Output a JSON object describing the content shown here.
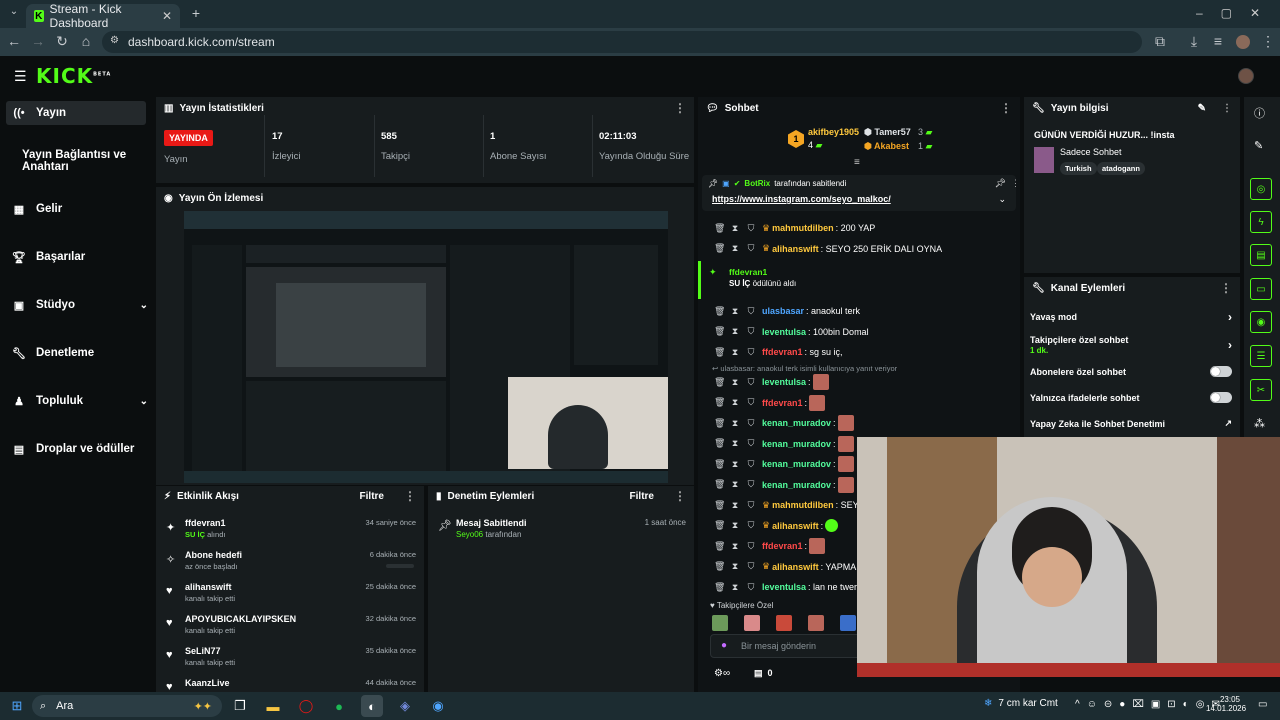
{
  "browser": {
    "tab_title": "Stream - Kick Dashboard",
    "url": "dashboard.kick.com/stream"
  },
  "kick": {
    "logo": "KICK",
    "logo_tag": "BETA"
  },
  "nav": {
    "items": [
      {
        "label": "Yayın",
        "icon": "broadcast-icon"
      },
      {
        "label": "Yayın Bağlantısı ve Anahtarı",
        "icon": ""
      },
      {
        "label": "Gelir",
        "icon": "revenue-icon"
      },
      {
        "label": "Başarılar",
        "icon": "trophy-icon"
      },
      {
        "label": "Stüdyo",
        "icon": "studio-icon"
      },
      {
        "label": "Denetleme",
        "icon": "wrench-icon"
      },
      {
        "label": "Topluluk",
        "icon": "community-icon"
      },
      {
        "label": "Droplar ve ödüller",
        "icon": "gift-icon"
      }
    ]
  },
  "stats": {
    "title": "Yayın İstatistikleri",
    "live_badge": "YAYINDA",
    "live_label": "Yayın",
    "viewers": "17",
    "viewers_label": "İzleyici",
    "followers": "585",
    "followers_label": "Takipçi",
    "subs": "1",
    "subs_label": "Abone Sayısı",
    "duration": "02:11:03",
    "duration_label": "Yayında Olduğu Süre"
  },
  "preview": {
    "title": "Yayın Ön İzlemesi"
  },
  "activity": {
    "title": "Etkinlik Akışı",
    "filter": "Filtre",
    "items": [
      {
        "name": "ffdevran1",
        "desc_green": "SU İÇ",
        "desc": " alındı",
        "time": "34 saniye önce"
      },
      {
        "name": "Abone hedefi",
        "desc_green": "",
        "desc": "az önce başladı",
        "time": "6 dakika önce"
      },
      {
        "name": "alihanswift",
        "desc_green": "",
        "desc": "kanalı takip etti",
        "time": "25 dakika önce"
      },
      {
        "name": "APOYUBICAKLAYIPSKEN",
        "desc_green": "",
        "desc": "kanalı takip etti",
        "time": "32 dakika önce"
      },
      {
        "name": "SeLiN77",
        "desc_green": "",
        "desc": "kanalı takip etti",
        "time": "35 dakika önce"
      },
      {
        "name": "KaanzLive",
        "desc_green": "",
        "desc": "",
        "time": "44 dakika önce"
      }
    ]
  },
  "moderation": {
    "title": "Denetim Eylemleri",
    "filter": "Filtre",
    "item_title": "Mesaj Sabitlendi",
    "item_user": "Seyo06",
    "item_suffix": " tarafından",
    "item_time": "1 saat önce"
  },
  "chat": {
    "title": "Sohbet",
    "top_user1": "akifbey1905",
    "top_user1_count": "4",
    "top_user2": "Tamer57",
    "top_user2_count": "3",
    "top_user3": "Akabest",
    "top_user3_count": "1",
    "pinned_by": "BotRix",
    "pinned_suffix": " tarafından sabitlendi",
    "pinned_link": "https://www.instagram.com/seyo_malkoc/",
    "reward_user": "ffdevran1",
    "reward_text": "SU İÇ",
    "reward_suffix": " ödülünü aldı",
    "reply_hint": "ulasbasar: anaokul terk isimli kullanıcıya yanıt veriyor",
    "messages": [
      {
        "user": "mahmutdilben",
        "text": ": 200 YAP",
        "color": "#ffc93e"
      },
      {
        "user": "alihanswift",
        "text": ": SEYO 250 ERİK DALI OYNA",
        "color": "#ffc93e"
      }
    ],
    "messages2": [
      {
        "user": "ulasbasar",
        "text": ": anaokul terk",
        "color": "#4fa6ff"
      },
      {
        "user": "leventulsa",
        "text": ": 100bin Domal",
        "color": "#53fc9c"
      },
      {
        "user": "ffdevran1",
        "text": ": sg su iç,",
        "color": "#ff4a4a"
      }
    ],
    "messages3": [
      {
        "user": "leventulsa",
        "text": ":",
        "color": "#53fc9c"
      },
      {
        "user": "ffdevran1",
        "text": ":",
        "color": "#ff4a4a"
      },
      {
        "user": "kenan_muradov",
        "text": ":",
        "color": "#53fc9c"
      },
      {
        "user": "kenan_muradov",
        "text": ":",
        "color": "#53fc9c"
      },
      {
        "user": "kenan_muradov",
        "text": ":",
        "color": "#53fc9c"
      },
      {
        "user": "kenan_muradov",
        "text": ":",
        "color": "#53fc9c"
      },
      {
        "user": "mahmutdilben",
        "text": ": SEYO BE",
        "color": "#ffc93e"
      },
      {
        "user": "alihanswift",
        "text": ":",
        "color": "#ffc93e"
      },
      {
        "user": "ffdevran1",
        "text": ":",
        "color": "#ff4a4a"
      },
      {
        "user": "alihanswift",
        "text": ": YAPMA",
        "color": "#ffc93e"
      },
      {
        "user": "leventulsa",
        "text": ": lan ne twerki",
        "color": "#53fc9c"
      }
    ],
    "followers_only": "Takipçilere Özel",
    "input_placeholder": "Bir mesaj gönderin",
    "footer_count": "0"
  },
  "stream_info": {
    "title": "Yayın bilgisi",
    "stream_title": "GÜNÜN VERDİĞİ HUZUR... !insta",
    "category": "Sadece Sohbet",
    "tags": [
      "Turkish",
      "atadogann"
    ]
  },
  "channel_actions": {
    "title": "Kanal Eylemleri",
    "slow_mode": "Yavaş mod",
    "followers_chat": "Takipçilere özel sohbet",
    "followers_chat_value": "1 dk.",
    "subs_chat": "Abonelere özel sohbet",
    "emote_chat": "Yalnızca ifadelerle sohbet",
    "ai_moderation": "Yapay Zeka ile Sohbet Denetimi"
  },
  "taskbar": {
    "search": "Ara",
    "weather": "7 cm kar Cmt",
    "time": "23:05",
    "date": "14.01.2026"
  }
}
